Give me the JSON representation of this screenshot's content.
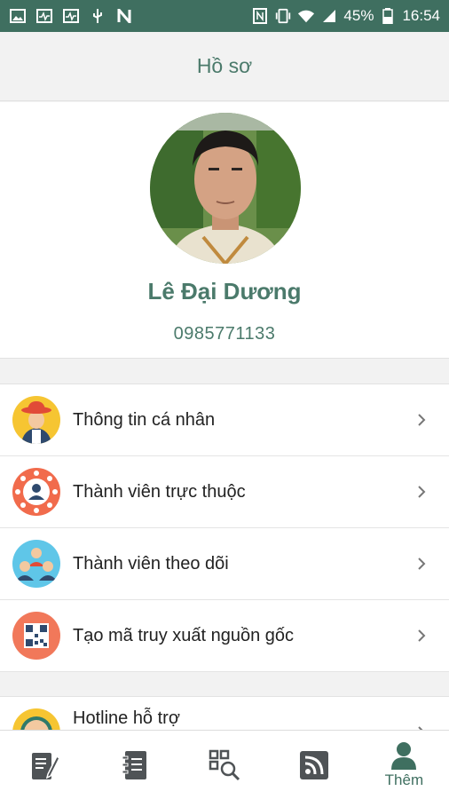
{
  "status_bar": {
    "battery": "45%",
    "time": "16:54",
    "left_icons": [
      "image-icon",
      "activity-icon",
      "activity-icon",
      "usb-icon",
      "n-icon"
    ],
    "right_icons": [
      "nfc-icon",
      "vibrate-icon",
      "wifi-icon",
      "signal-icon",
      "battery-icon"
    ]
  },
  "header": {
    "title": "Hồ sơ"
  },
  "profile": {
    "name": "Lê Đại Dương",
    "phone": "0985771133"
  },
  "menu": {
    "items": [
      {
        "label": "Thông tin cá nhân",
        "icon": "farmer-icon"
      },
      {
        "label": "Thành viên trực thuộc",
        "icon": "member-group-icon"
      },
      {
        "label": "Thành viên theo dõi",
        "icon": "followers-icon"
      },
      {
        "label": "Tạo mã truy xuất nguồn gốc",
        "icon": "qr-code-icon"
      }
    ],
    "partial_item": {
      "label": "Hotline hỗ trợ",
      "icon": "hotline-icon"
    }
  },
  "bottom_nav": {
    "items": [
      {
        "icon": "edit-document-icon",
        "label": ""
      },
      {
        "icon": "notebook-icon",
        "label": ""
      },
      {
        "icon": "qr-scan-icon",
        "label": ""
      },
      {
        "icon": "rss-icon",
        "label": ""
      },
      {
        "icon": "person-icon",
        "label": "Thêm"
      }
    ]
  },
  "colors": {
    "primary": "#3f6f60",
    "text_green": "#4b7a6b",
    "background": "#f2f2f2"
  }
}
